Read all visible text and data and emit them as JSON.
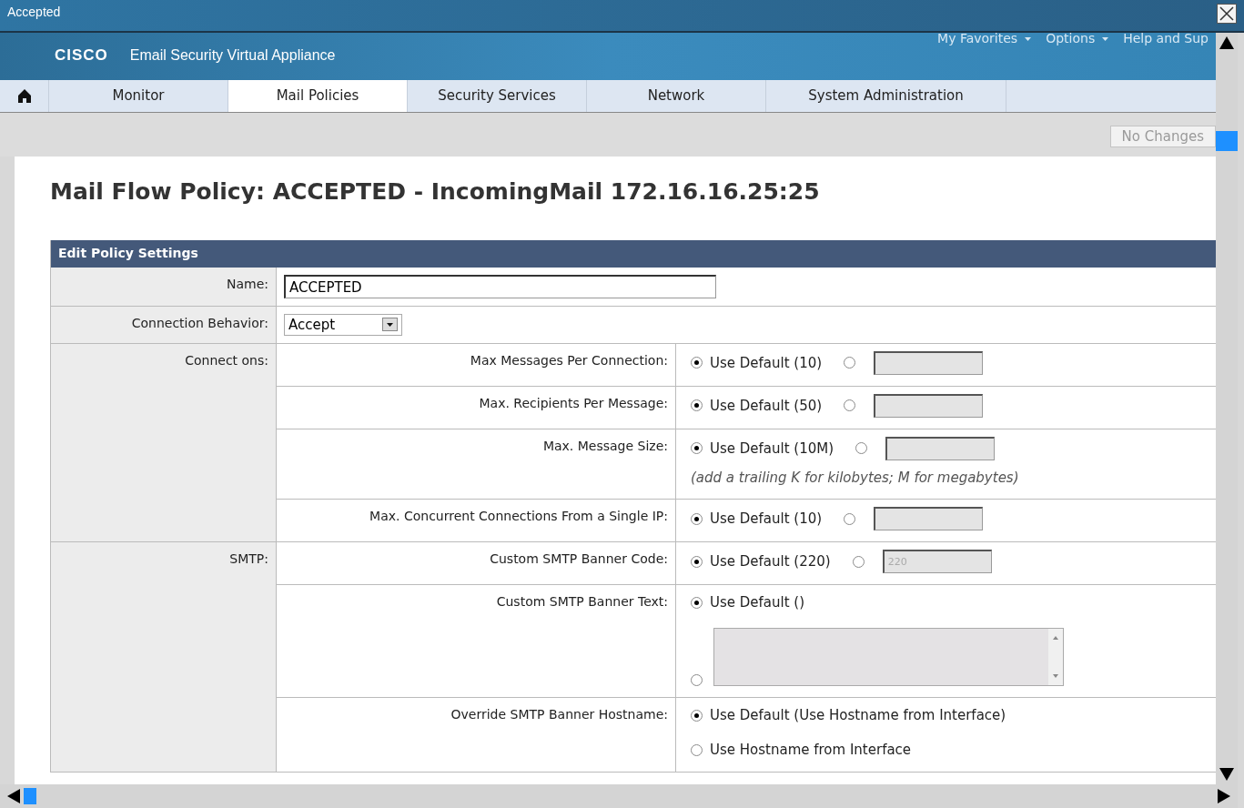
{
  "window": {
    "title": "Accepted"
  },
  "header": {
    "brand": "CISCO",
    "product": "Email Security Virtual Appliance",
    "links": [
      "My Favorites",
      "Options",
      "Help and Sup"
    ]
  },
  "nav": [
    {
      "label": "Monitor",
      "selected": false
    },
    {
      "label": "Mail Policies",
      "selected": true
    },
    {
      "label": "Security Services",
      "selected": false
    },
    {
      "label": "Network",
      "selected": false
    },
    {
      "label": "System Administration",
      "selected": false
    }
  ],
  "toolbar": {
    "button": "No Changes"
  },
  "page_title": "Mail Flow Policy: ACCEPTED - IncomingMail 172.16.16.25:25",
  "section": {
    "title": "Edit Policy Settings",
    "rows": [
      {
        "kind": "text",
        "label": "Name:",
        "value": "ACCEPTED"
      },
      {
        "kind": "select",
        "label": "Connection Behavior:",
        "value": "Accept"
      },
      {
        "kind": "group",
        "label": "Connect ons:",
        "settings": [
          {
            "label": "Max  Messages Per Connection:",
            "kind": "inline",
            "options": [
              {
                "kind": "default",
                "label": "Use Default (10)",
                "selected": true
              },
              {
                "kind": "input",
                "selected": false,
                "disabled": true
              }
            ]
          },
          {
            "label": "Max. Recipients Per Message:",
            "kind": "inline",
            "options": [
              {
                "kind": "default",
                "label": "Use Default (50)",
                "selected": true
              },
              {
                "kind": "input",
                "selected": false,
                "disabled": true
              }
            ]
          },
          {
            "label": "Max. Message Size:",
            "kind": "inline",
            "note": "(add a trailing K for kilobytes; M for megabytes)",
            "options": [
              {
                "kind": "default",
                "label": "Use Default (10M)",
                "selected": true
              },
              {
                "kind": "input",
                "selected": false,
                "disabled": true
              }
            ]
          },
          {
            "label": "Max. Concurrent Connections From a Single IP:",
            "kind": "inline",
            "options": [
              {
                "kind": "default",
                "label": "Use Default (10)",
                "selected": true
              },
              {
                "kind": "input",
                "selected": false,
                "disabled": true
              }
            ]
          }
        ]
      },
      {
        "kind": "group",
        "label": "SMTP:",
        "settings": [
          {
            "label": "Custom SMTP Banner Code:",
            "kind": "inline",
            "options": [
              {
                "kind": "default",
                "label": "Use Default (220)",
                "selected": true
              },
              {
                "kind": "input",
                "selected": false,
                "disabled": true,
                "value": "220"
              }
            ]
          },
          {
            "label": "Custom SMTP Banner Text:",
            "kind": "stacked",
            "options": [
              {
                "kind": "default",
                "label": "Use Default ()",
                "selected": true
              },
              {
                "kind": "textarea",
                "selected": false
              }
            ]
          },
          {
            "label": "Override SMTP Banner Hostname:",
            "kind": "stacked",
            "options": [
              {
                "kind": "default",
                "label": "Use Default (Use Hostname from Interface)",
                "selected": true
              },
              {
                "kind": "default",
                "label": "Use Hostname from Interface",
                "selected": false
              }
            ]
          }
        ]
      }
    ]
  }
}
